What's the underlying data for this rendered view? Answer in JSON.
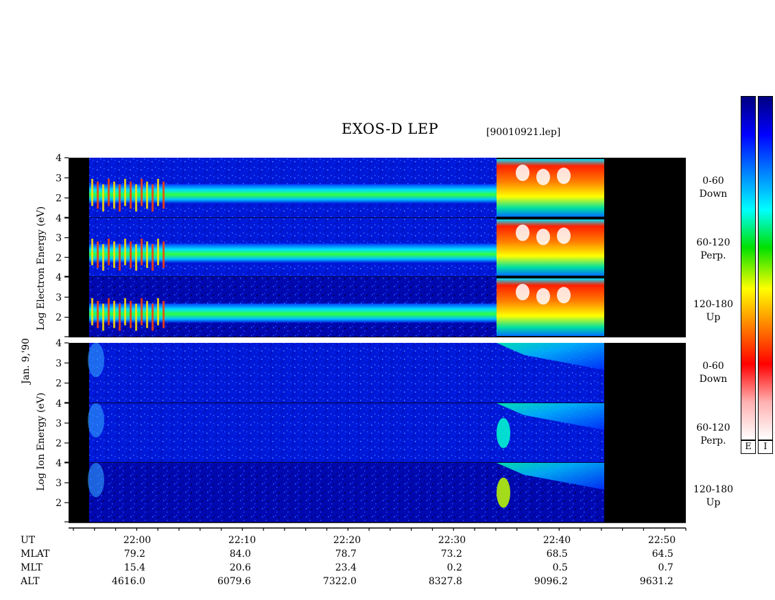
{
  "chart_data": {
    "type": "heatmap",
    "title": "EXOS-D LEP",
    "file_label": "[90010921.lep]",
    "date_label": "Jan. 9,'90",
    "electron_axis_label": "Log  Electron  Energy (eV)",
    "ion_axis_label": "Log  Ion  Energy (eV)",
    "y_ticks": [
      "4",
      "3",
      "2"
    ],
    "y_range": [
      1,
      4
    ],
    "x_ticks": [
      "22:00",
      "22:10",
      "22:20",
      "22:30",
      "22:40",
      "22:50"
    ],
    "x_range": [
      "21:55",
      "22:53"
    ],
    "data_coverage": [
      "21:55",
      "22:45"
    ],
    "particles": [
      "Electron",
      "Ion"
    ],
    "pitch_angle_panels": [
      {
        "range": "0-60",
        "direction": "Down"
      },
      {
        "range": "60-120",
        "direction": "Perp."
      },
      {
        "range": "120-180",
        "direction": "Up"
      }
    ],
    "colorbar_labels": [
      "E",
      "I"
    ],
    "colormap": [
      "#ffffff",
      "#ffb0b0",
      "#ff0000",
      "#ff8000",
      "#ffff00",
      "#00e000",
      "#00ffff",
      "#0080ff",
      "#0000ff",
      "#000080"
    ],
    "orbit_rows": [
      {
        "label": "UT",
        "values": [
          "",
          "",
          "",
          "",
          "",
          ""
        ]
      },
      {
        "label": "MLAT",
        "values": [
          "79.2",
          "84.0",
          "78.7",
          "73.2",
          "68.5",
          "64.5"
        ]
      },
      {
        "label": "MLT",
        "values": [
          "15.4",
          "20.6",
          "23.4",
          "0.2",
          "0.5",
          "0.7"
        ]
      },
      {
        "label": "ALT",
        "values": [
          "4616.0",
          "6079.6",
          "7322.0",
          "8327.8",
          "9096.2",
          "9631.2"
        ]
      }
    ]
  }
}
